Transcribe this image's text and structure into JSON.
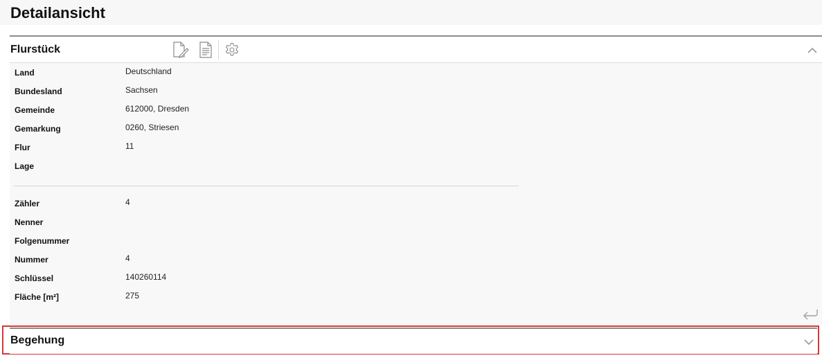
{
  "page": {
    "title": "Detailansicht"
  },
  "flurstueck": {
    "title": "Flurstück",
    "tools": [
      "edit-document-icon",
      "document-icon",
      "settings-gear-icon"
    ],
    "fields_top": [
      {
        "label": "Land",
        "value": "Deutschland"
      },
      {
        "label": "Bundesland",
        "value": "Sachsen"
      },
      {
        "label": "Gemeinde",
        "value": "612000, Dresden"
      },
      {
        "label": "Gemarkung",
        "value": "0260, Striesen"
      },
      {
        "label": "Flur",
        "value": "11"
      },
      {
        "label": "Lage",
        "value": ""
      }
    ],
    "fields_bottom": [
      {
        "label": "Zähler",
        "value": "4"
      },
      {
        "label": "Nenner",
        "value": ""
      },
      {
        "label": "Folgenummer",
        "value": ""
      },
      {
        "label": "Nummer",
        "value": "4"
      },
      {
        "label": "Schlüssel",
        "value": "140260114"
      },
      {
        "label": "Fläche [m²]",
        "value": "275"
      }
    ]
  },
  "begehung": {
    "title": "Begehung"
  },
  "colors": {
    "highlight_border": "#d9363b",
    "panel_top_border": "#8a8a8a"
  }
}
